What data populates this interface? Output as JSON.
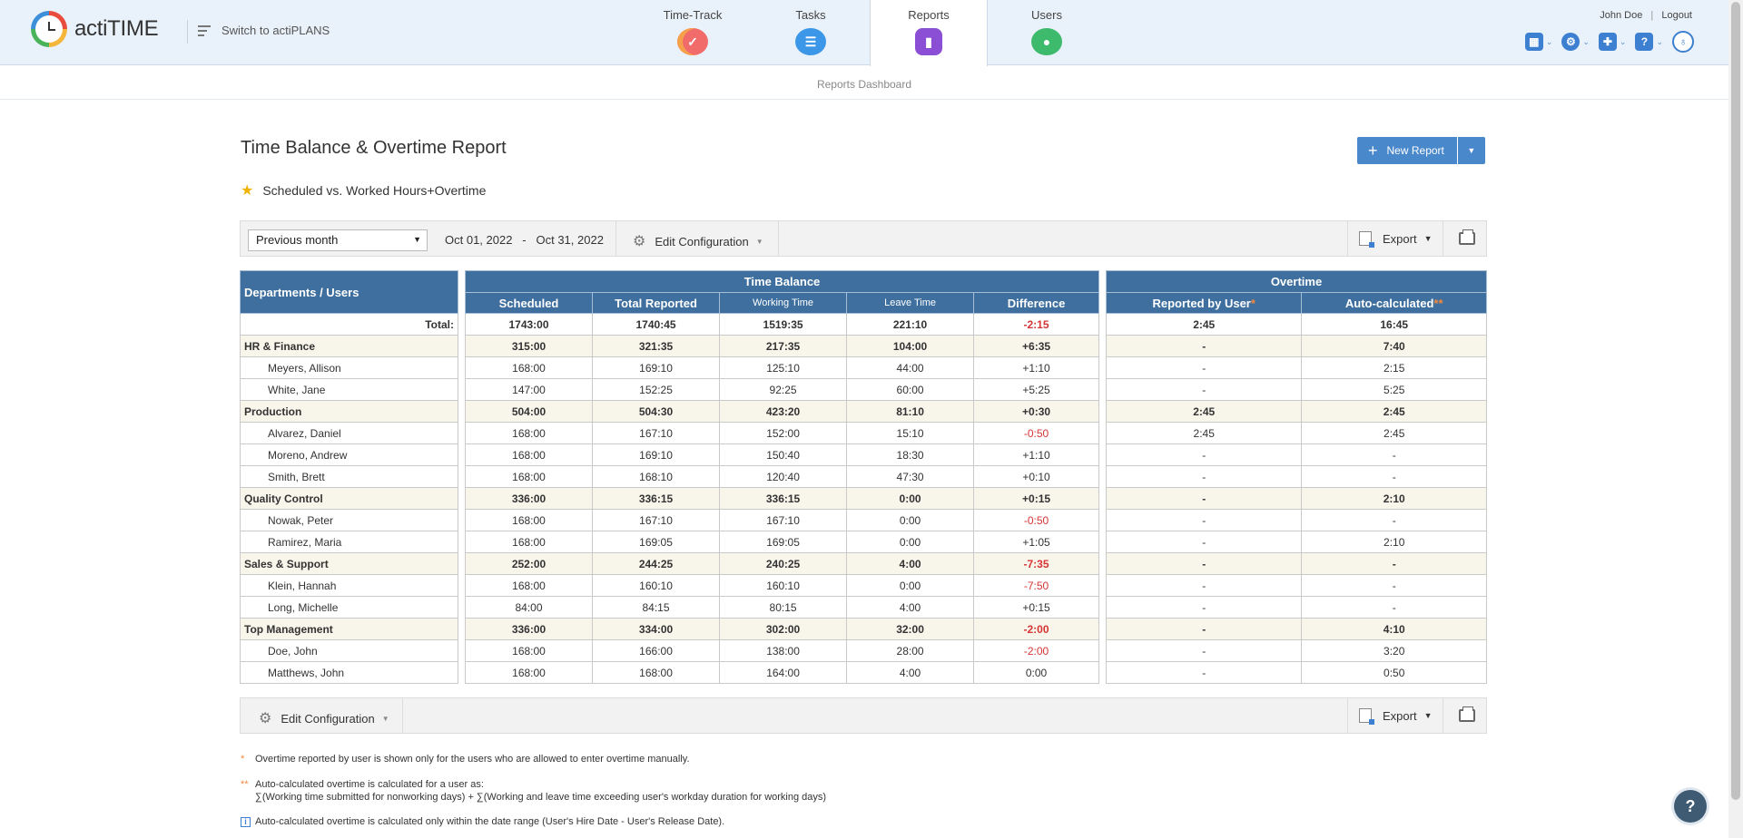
{
  "app": {
    "logo_text": "actiTIME",
    "switch_label": "Switch to actiPLANS"
  },
  "nav": [
    {
      "label": "Time-Track",
      "icon": "time-track-icon"
    },
    {
      "label": "Tasks",
      "icon": "tasks-icon"
    },
    {
      "label": "Reports",
      "icon": "reports-icon",
      "active": true
    },
    {
      "label": "Users",
      "icon": "users-icon"
    }
  ],
  "user": {
    "name": "John Doe",
    "logout": "Logout"
  },
  "subnav": {
    "label": "Reports Dashboard"
  },
  "report": {
    "title": "Time Balance & Overtime Report",
    "new_report": "New Report",
    "config_name": "Scheduled vs. Worked Hours+Overtime"
  },
  "toolbar": {
    "period": "Previous month",
    "date_from": "Oct 01, 2022",
    "date_sep": "-",
    "date_to": "Oct 31, 2022",
    "edit_config": "Edit Configuration",
    "export": "Export"
  },
  "table": {
    "dept_header": "Departments / Users",
    "time_balance_header": "Time Balance",
    "overtime_header": "Overtime",
    "cols": {
      "scheduled": "Scheduled",
      "total_reported": "Total Reported",
      "working_time": "Working Time",
      "leave_time": "Leave Time",
      "difference": "Difference",
      "reported_by_user": "Reported by User",
      "auto_calculated": "Auto-calculated"
    },
    "marks": {
      "single": "*",
      "double": "**"
    },
    "rows": [
      {
        "type": "total",
        "name": "Total:",
        "scheduled": "1743:00",
        "total": "1740:45",
        "working": "1519:35",
        "leave": "221:10",
        "diff": "-2:15",
        "neg": true,
        "by_user": "2:45",
        "auto": "16:45"
      },
      {
        "type": "dept",
        "name": "HR & Finance",
        "scheduled": "315:00",
        "total": "321:35",
        "working": "217:35",
        "leave": "104:00",
        "diff": "+6:35",
        "neg": false,
        "by_user": "-",
        "auto": "7:40"
      },
      {
        "type": "user",
        "name": "Meyers, Allison",
        "scheduled": "168:00",
        "total": "169:10",
        "working": "125:10",
        "leave": "44:00",
        "diff": "+1:10",
        "neg": false,
        "by_user": "-",
        "auto": "2:15"
      },
      {
        "type": "user",
        "name": "White, Jane",
        "scheduled": "147:00",
        "total": "152:25",
        "working": "92:25",
        "leave": "60:00",
        "diff": "+5:25",
        "neg": false,
        "by_user": "-",
        "auto": "5:25"
      },
      {
        "type": "dept",
        "name": "Production",
        "scheduled": "504:00",
        "total": "504:30",
        "working": "423:20",
        "leave": "81:10",
        "diff": "+0:30",
        "neg": false,
        "by_user": "2:45",
        "auto": "2:45"
      },
      {
        "type": "user",
        "name": "Alvarez, Daniel",
        "scheduled": "168:00",
        "total": "167:10",
        "working": "152:00",
        "leave": "15:10",
        "diff": "-0:50",
        "neg": true,
        "by_user": "2:45",
        "auto": "2:45"
      },
      {
        "type": "user",
        "name": "Moreno, Andrew",
        "scheduled": "168:00",
        "total": "169:10",
        "working": "150:40",
        "leave": "18:30",
        "diff": "+1:10",
        "neg": false,
        "by_user": "-",
        "auto": "-"
      },
      {
        "type": "user",
        "name": "Smith, Brett",
        "scheduled": "168:00",
        "total": "168:10",
        "working": "120:40",
        "leave": "47:30",
        "diff": "+0:10",
        "neg": false,
        "by_user": "-",
        "auto": "-"
      },
      {
        "type": "dept",
        "name": "Quality Control",
        "scheduled": "336:00",
        "total": "336:15",
        "working": "336:15",
        "leave": "0:00",
        "diff": "+0:15",
        "neg": false,
        "by_user": "-",
        "auto": "2:10"
      },
      {
        "type": "user",
        "name": "Nowak, Peter",
        "scheduled": "168:00",
        "total": "167:10",
        "working": "167:10",
        "leave": "0:00",
        "diff": "-0:50",
        "neg": true,
        "by_user": "-",
        "auto": "-"
      },
      {
        "type": "user",
        "name": "Ramirez, Maria",
        "scheduled": "168:00",
        "total": "169:05",
        "working": "169:05",
        "leave": "0:00",
        "diff": "+1:05",
        "neg": false,
        "by_user": "-",
        "auto": "2:10"
      },
      {
        "type": "dept",
        "name": "Sales & Support",
        "scheduled": "252:00",
        "total": "244:25",
        "working": "240:25",
        "leave": "4:00",
        "diff": "-7:35",
        "neg": true,
        "by_user": "-",
        "auto": "-"
      },
      {
        "type": "user",
        "name": "Klein, Hannah",
        "scheduled": "168:00",
        "total": "160:10",
        "working": "160:10",
        "leave": "0:00",
        "diff": "-7:50",
        "neg": true,
        "by_user": "-",
        "auto": "-"
      },
      {
        "type": "user",
        "name": "Long, Michelle",
        "scheduled": "84:00",
        "total": "84:15",
        "working": "80:15",
        "leave": "4:00",
        "diff": "+0:15",
        "neg": false,
        "by_user": "-",
        "auto": "-"
      },
      {
        "type": "dept",
        "name": "Top Management",
        "scheduled": "336:00",
        "total": "334:00",
        "working": "302:00",
        "leave": "32:00",
        "diff": "-2:00",
        "neg": true,
        "by_user": "-",
        "auto": "4:10"
      },
      {
        "type": "user",
        "name": "Doe, John",
        "scheduled": "168:00",
        "total": "166:00",
        "working": "138:00",
        "leave": "28:00",
        "diff": "-2:00",
        "neg": true,
        "by_user": "-",
        "auto": "3:20"
      },
      {
        "type": "user",
        "name": "Matthews, John",
        "scheduled": "168:00",
        "total": "168:00",
        "working": "164:00",
        "leave": "4:00",
        "diff": "0:00",
        "neg": false,
        "by_user": "-",
        "auto": "0:50"
      }
    ]
  },
  "footnotes": {
    "note1": "Overtime reported by user is shown only for the users who are allowed to enter overtime manually.",
    "note2_line1": "Auto-calculated overtime is calculated for a user as:",
    "note2_line2": "∑(Working time submitted for nonworking days) + ∑(Working and leave time exceeding user's workday duration for working days)",
    "note3": "Auto-calculated overtime is calculated only within the date range (User's Hire Date - User's Release Date)."
  },
  "help_fab": "?",
  "colors": {
    "header_blue": "#3e6f9e",
    "accent_blue": "#4a88cc",
    "negative_red": "#d73434",
    "dept_row_bg": "#f8f5eb"
  }
}
